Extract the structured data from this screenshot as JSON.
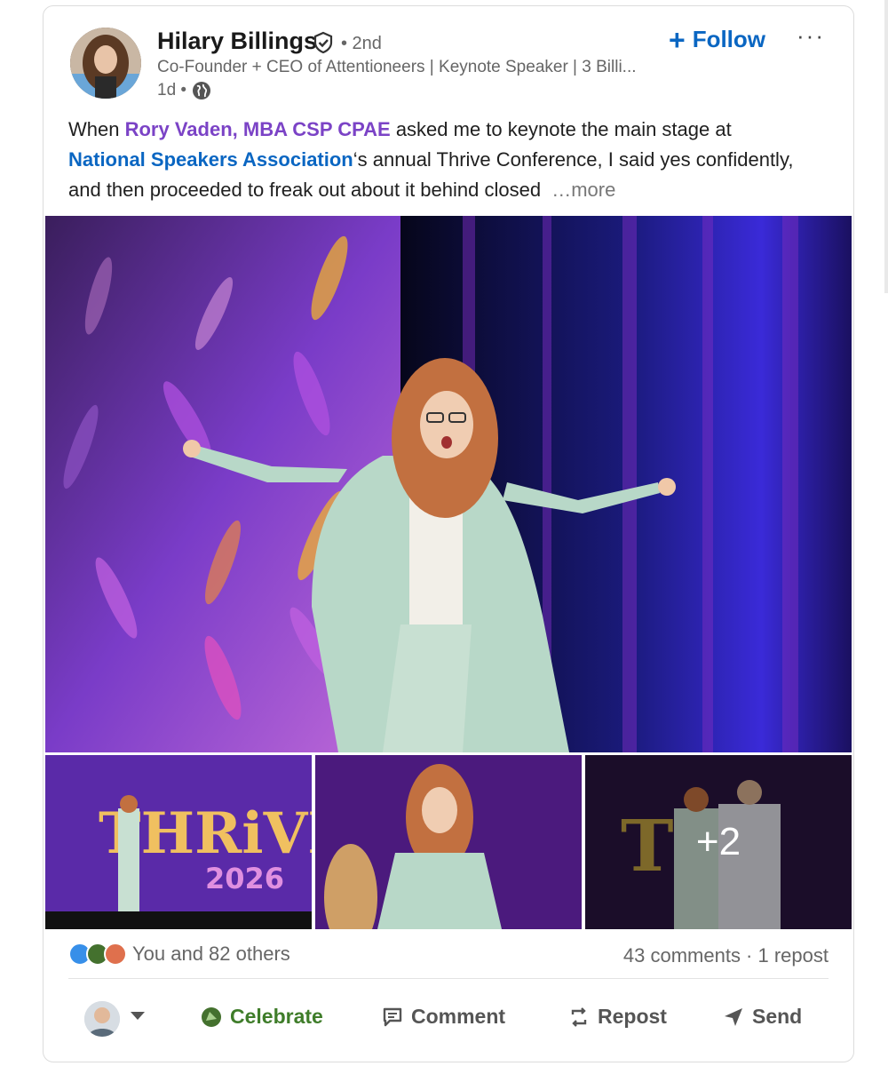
{
  "author": {
    "name": "Hilary Billings",
    "degree": "• 2nd",
    "headline": "Co-Founder + CEO of Attentioneers | Keynote Speaker | 3 Billi...",
    "time": "1d •"
  },
  "header": {
    "follow_label": "Follow",
    "follow_plus": "+",
    "more_label": "···"
  },
  "post": {
    "text_1": "When ",
    "mention_person": "Rory Vaden, MBA CSP CPAE",
    "text_2": " asked me to keynote the main stage at ",
    "mention_org": "National Speakers Association",
    "text_3": "‘s annual Thrive Conference, I said yes confidently, and then proceeded to freak out about it behind closed ",
    "see_more": "…more"
  },
  "media": {
    "extra_count": "+2"
  },
  "social": {
    "reactions_text": "You and 82 others",
    "counts_text": "43 comments · 1 repost"
  },
  "actions": {
    "celebrate": "Celebrate",
    "comment": "Comment",
    "repost": "Repost",
    "send": "Send"
  },
  "colors": {
    "brand_blue": "#0a66c2",
    "mention_purple": "#7b43c6",
    "celebrate_green": "#3f7d2a"
  }
}
